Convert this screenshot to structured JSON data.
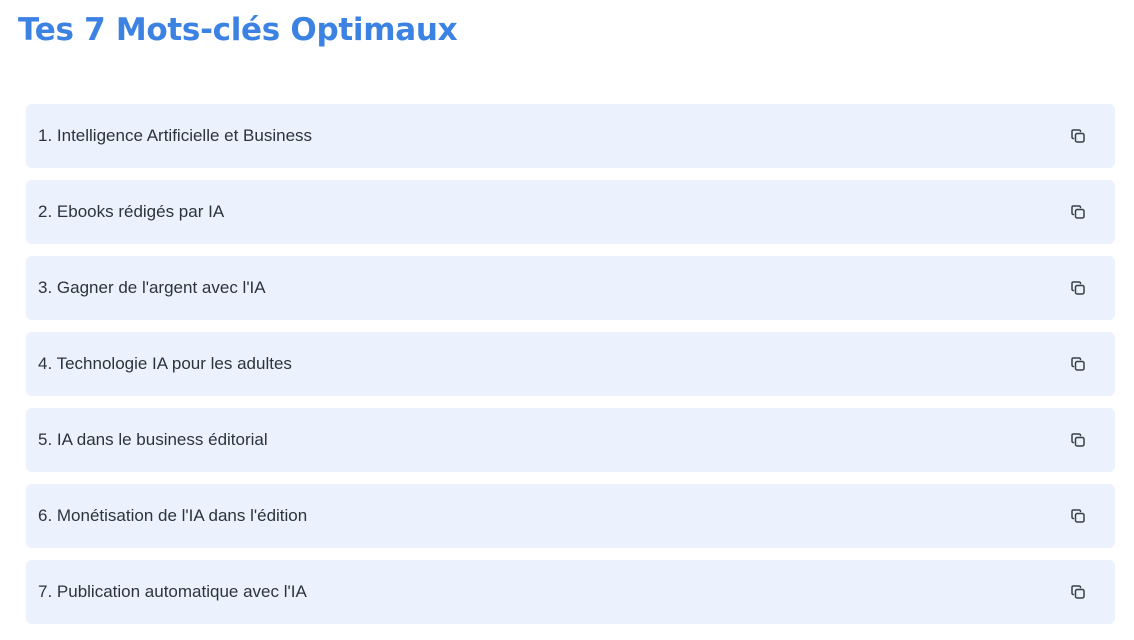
{
  "header": {
    "title": "Tes 7 Mots-clés Optimaux"
  },
  "keywords": [
    {
      "label": "1. Intelligence Artificielle et Business"
    },
    {
      "label": "2. Ebooks rédigés par IA"
    },
    {
      "label": "3. Gagner de l'argent avec l'IA"
    },
    {
      "label": "4. Technologie IA pour les adultes"
    },
    {
      "label": "5. IA dans le business éditorial"
    },
    {
      "label": "6. Monétisation de l'IA dans l'édition"
    },
    {
      "label": "7. Publication automatique avec l'IA"
    }
  ],
  "icons": {
    "copy": "copy-icon"
  },
  "colors": {
    "title": "#3b82e3",
    "item_background": "#ebf2fd",
    "text": "#2e333b",
    "icon": "#3a3f46"
  }
}
